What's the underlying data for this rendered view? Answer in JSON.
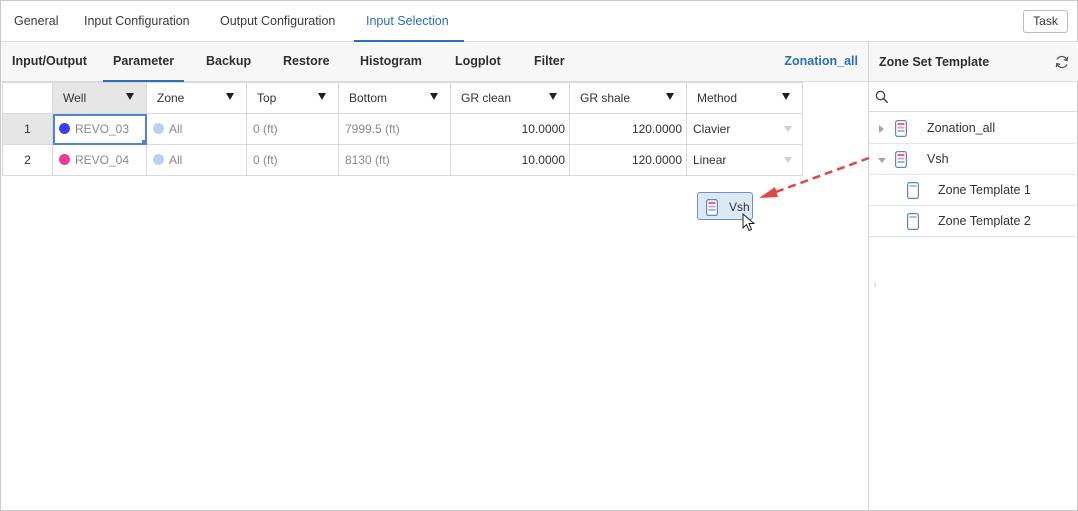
{
  "top_tabs": [
    {
      "label": "General"
    },
    {
      "label": "Input Configuration"
    },
    {
      "label": "Output Configuration"
    },
    {
      "label": "Input Selection",
      "active": true
    }
  ],
  "task_button": "Task",
  "sub_tabs": [
    {
      "label": "Input/Output"
    },
    {
      "label": "Parameter",
      "active": true
    },
    {
      "label": "Backup"
    },
    {
      "label": "Restore"
    },
    {
      "label": "Histogram"
    },
    {
      "label": "Logplot"
    },
    {
      "label": "Filter"
    }
  ],
  "zonation_link": "Zonation_all",
  "grid": {
    "columns": [
      "Well",
      "Zone",
      "Top",
      "Bottom",
      "GR clean",
      "GR shale",
      "Method"
    ],
    "rows": [
      {
        "num": "1",
        "well": "REVO_03",
        "well_color": "#3b3ff0",
        "zone": "All",
        "top": "0 (ft)",
        "bottom": "7999.5 (ft)",
        "gr_clean": "10.0000",
        "gr_shale": "120.0000",
        "method": "Clavier"
      },
      {
        "num": "2",
        "well": "REVO_04",
        "well_color": "#ee3b9a",
        "zone": "All",
        "top": "0 (ft)",
        "bottom": "8130 (ft)",
        "gr_clean": "10.0000",
        "gr_shale": "120.0000",
        "method": "Linear"
      }
    ]
  },
  "right_panel": {
    "title": "Zone Set Template",
    "search_placeholder": "",
    "tree": [
      {
        "label": "Zonation_all",
        "expanded": false
      },
      {
        "label": "Vsh",
        "expanded": true
      },
      {
        "label": "Zone Template 1"
      },
      {
        "label": "Zone Template 2"
      }
    ]
  },
  "drag_chip": {
    "label": "Vsh"
  },
  "colors": {
    "accent": "#2b6fb5",
    "drag_arrow": "#e04848",
    "chip_bg": "#dce8f5"
  },
  "icons": [
    "refresh-icon",
    "search-icon",
    "zone-set-icon",
    "zone-template-icon",
    "mouse-cursor-icon"
  ]
}
